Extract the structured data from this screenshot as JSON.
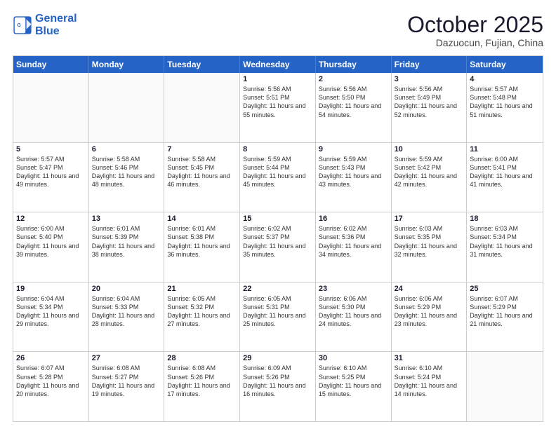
{
  "header": {
    "logo_line1": "General",
    "logo_line2": "Blue",
    "month": "October 2025",
    "location": "Dazuocun, Fujian, China"
  },
  "weekdays": [
    "Sunday",
    "Monday",
    "Tuesday",
    "Wednesday",
    "Thursday",
    "Friday",
    "Saturday"
  ],
  "rows": [
    [
      {
        "day": "",
        "sunrise": "",
        "sunset": "",
        "daylight": ""
      },
      {
        "day": "",
        "sunrise": "",
        "sunset": "",
        "daylight": ""
      },
      {
        "day": "",
        "sunrise": "",
        "sunset": "",
        "daylight": ""
      },
      {
        "day": "1",
        "sunrise": "Sunrise: 5:56 AM",
        "sunset": "Sunset: 5:51 PM",
        "daylight": "Daylight: 11 hours and 55 minutes."
      },
      {
        "day": "2",
        "sunrise": "Sunrise: 5:56 AM",
        "sunset": "Sunset: 5:50 PM",
        "daylight": "Daylight: 11 hours and 54 minutes."
      },
      {
        "day": "3",
        "sunrise": "Sunrise: 5:56 AM",
        "sunset": "Sunset: 5:49 PM",
        "daylight": "Daylight: 11 hours and 52 minutes."
      },
      {
        "day": "4",
        "sunrise": "Sunrise: 5:57 AM",
        "sunset": "Sunset: 5:48 PM",
        "daylight": "Daylight: 11 hours and 51 minutes."
      }
    ],
    [
      {
        "day": "5",
        "sunrise": "Sunrise: 5:57 AM",
        "sunset": "Sunset: 5:47 PM",
        "daylight": "Daylight: 11 hours and 49 minutes."
      },
      {
        "day": "6",
        "sunrise": "Sunrise: 5:58 AM",
        "sunset": "Sunset: 5:46 PM",
        "daylight": "Daylight: 11 hours and 48 minutes."
      },
      {
        "day": "7",
        "sunrise": "Sunrise: 5:58 AM",
        "sunset": "Sunset: 5:45 PM",
        "daylight": "Daylight: 11 hours and 46 minutes."
      },
      {
        "day": "8",
        "sunrise": "Sunrise: 5:59 AM",
        "sunset": "Sunset: 5:44 PM",
        "daylight": "Daylight: 11 hours and 45 minutes."
      },
      {
        "day": "9",
        "sunrise": "Sunrise: 5:59 AM",
        "sunset": "Sunset: 5:43 PM",
        "daylight": "Daylight: 11 hours and 43 minutes."
      },
      {
        "day": "10",
        "sunrise": "Sunrise: 5:59 AM",
        "sunset": "Sunset: 5:42 PM",
        "daylight": "Daylight: 11 hours and 42 minutes."
      },
      {
        "day": "11",
        "sunrise": "Sunrise: 6:00 AM",
        "sunset": "Sunset: 5:41 PM",
        "daylight": "Daylight: 11 hours and 41 minutes."
      }
    ],
    [
      {
        "day": "12",
        "sunrise": "Sunrise: 6:00 AM",
        "sunset": "Sunset: 5:40 PM",
        "daylight": "Daylight: 11 hours and 39 minutes."
      },
      {
        "day": "13",
        "sunrise": "Sunrise: 6:01 AM",
        "sunset": "Sunset: 5:39 PM",
        "daylight": "Daylight: 11 hours and 38 minutes."
      },
      {
        "day": "14",
        "sunrise": "Sunrise: 6:01 AM",
        "sunset": "Sunset: 5:38 PM",
        "daylight": "Daylight: 11 hours and 36 minutes."
      },
      {
        "day": "15",
        "sunrise": "Sunrise: 6:02 AM",
        "sunset": "Sunset: 5:37 PM",
        "daylight": "Daylight: 11 hours and 35 minutes."
      },
      {
        "day": "16",
        "sunrise": "Sunrise: 6:02 AM",
        "sunset": "Sunset: 5:36 PM",
        "daylight": "Daylight: 11 hours and 34 minutes."
      },
      {
        "day": "17",
        "sunrise": "Sunrise: 6:03 AM",
        "sunset": "Sunset: 5:35 PM",
        "daylight": "Daylight: 11 hours and 32 minutes."
      },
      {
        "day": "18",
        "sunrise": "Sunrise: 6:03 AM",
        "sunset": "Sunset: 5:34 PM",
        "daylight": "Daylight: 11 hours and 31 minutes."
      }
    ],
    [
      {
        "day": "19",
        "sunrise": "Sunrise: 6:04 AM",
        "sunset": "Sunset: 5:34 PM",
        "daylight": "Daylight: 11 hours and 29 minutes."
      },
      {
        "day": "20",
        "sunrise": "Sunrise: 6:04 AM",
        "sunset": "Sunset: 5:33 PM",
        "daylight": "Daylight: 11 hours and 28 minutes."
      },
      {
        "day": "21",
        "sunrise": "Sunrise: 6:05 AM",
        "sunset": "Sunset: 5:32 PM",
        "daylight": "Daylight: 11 hours and 27 minutes."
      },
      {
        "day": "22",
        "sunrise": "Sunrise: 6:05 AM",
        "sunset": "Sunset: 5:31 PM",
        "daylight": "Daylight: 11 hours and 25 minutes."
      },
      {
        "day": "23",
        "sunrise": "Sunrise: 6:06 AM",
        "sunset": "Sunset: 5:30 PM",
        "daylight": "Daylight: 11 hours and 24 minutes."
      },
      {
        "day": "24",
        "sunrise": "Sunrise: 6:06 AM",
        "sunset": "Sunset: 5:29 PM",
        "daylight": "Daylight: 11 hours and 23 minutes."
      },
      {
        "day": "25",
        "sunrise": "Sunrise: 6:07 AM",
        "sunset": "Sunset: 5:29 PM",
        "daylight": "Daylight: 11 hours and 21 minutes."
      }
    ],
    [
      {
        "day": "26",
        "sunrise": "Sunrise: 6:07 AM",
        "sunset": "Sunset: 5:28 PM",
        "daylight": "Daylight: 11 hours and 20 minutes."
      },
      {
        "day": "27",
        "sunrise": "Sunrise: 6:08 AM",
        "sunset": "Sunset: 5:27 PM",
        "daylight": "Daylight: 11 hours and 19 minutes."
      },
      {
        "day": "28",
        "sunrise": "Sunrise: 6:08 AM",
        "sunset": "Sunset: 5:26 PM",
        "daylight": "Daylight: 11 hours and 17 minutes."
      },
      {
        "day": "29",
        "sunrise": "Sunrise: 6:09 AM",
        "sunset": "Sunset: 5:26 PM",
        "daylight": "Daylight: 11 hours and 16 minutes."
      },
      {
        "day": "30",
        "sunrise": "Sunrise: 6:10 AM",
        "sunset": "Sunset: 5:25 PM",
        "daylight": "Daylight: 11 hours and 15 minutes."
      },
      {
        "day": "31",
        "sunrise": "Sunrise: 6:10 AM",
        "sunset": "Sunset: 5:24 PM",
        "daylight": "Daylight: 11 hours and 14 minutes."
      },
      {
        "day": "",
        "sunrise": "",
        "sunset": "",
        "daylight": ""
      }
    ]
  ],
  "accent_color": "#2563c7"
}
